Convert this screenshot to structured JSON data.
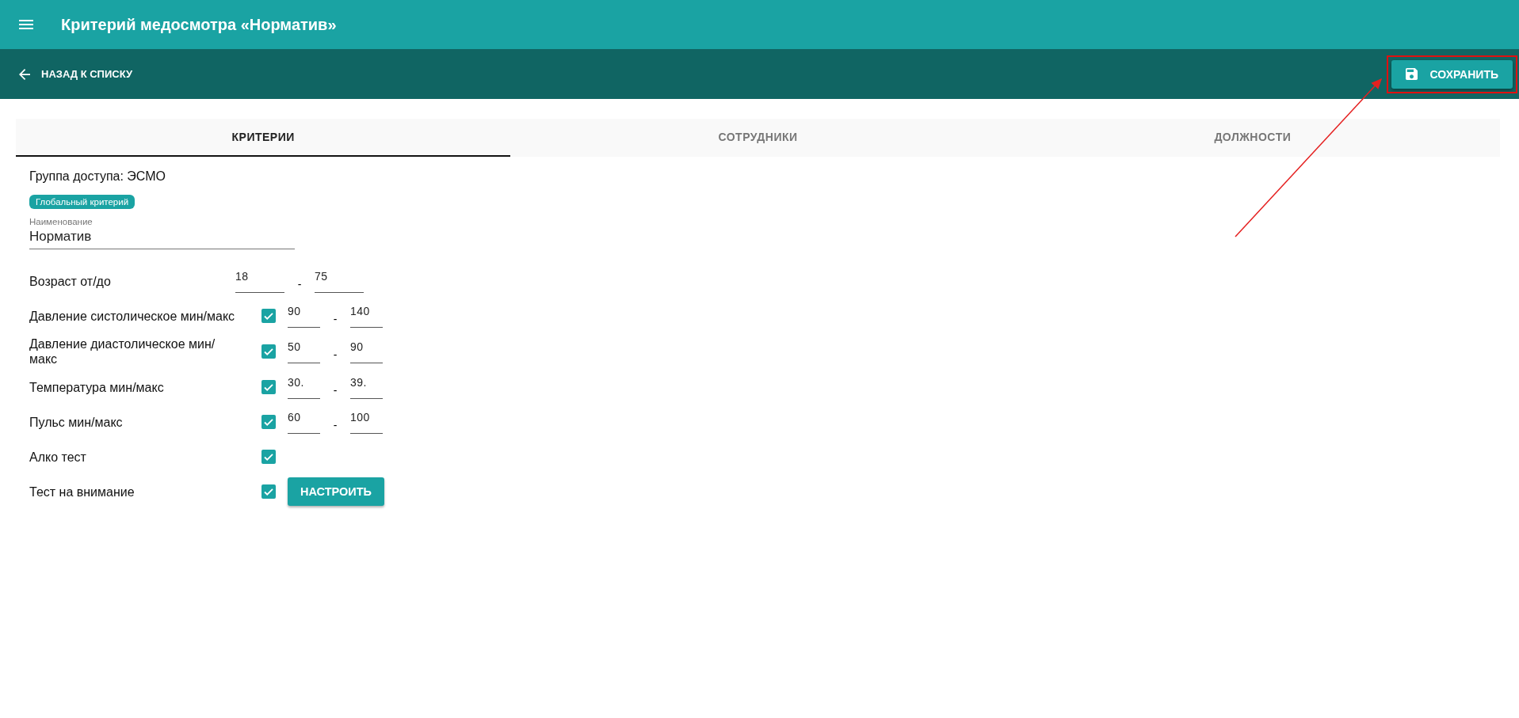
{
  "app_bar": {
    "title": "Критерий медосмотра «Норматив»"
  },
  "toolbar": {
    "back_label": "НАЗАД К СПИСКУ",
    "save_label": "СОХРАНИТЬ",
    "save_highlighted": true
  },
  "tabs": [
    {
      "label": "КРИТЕРИИ",
      "selected": true
    },
    {
      "label": "СОТРУДНИКИ",
      "selected": false
    },
    {
      "label": "ДОЛЖНОСТИ",
      "selected": false
    }
  ],
  "access_group": "Группа доступа: ЭСМО",
  "badge": "Глобальный критерий",
  "name_field": {
    "label": "Наименование",
    "value": "Норматив"
  },
  "criteria": [
    {
      "kind": "range",
      "label": "Возраст от/до",
      "min": "18",
      "max": "75",
      "separator": "-"
    },
    {
      "kind": "range_check",
      "label": "Давление систолическое мин/макс",
      "checked": true,
      "min": "90",
      "max": "140",
      "separator": "-"
    },
    {
      "kind": "range_check",
      "label": "Давление диастолическое мин/макс",
      "checked": true,
      "min": "50",
      "max": "90",
      "separator": "-"
    },
    {
      "kind": "range_check",
      "label": "Температура мин/макс",
      "checked": true,
      "min": "30.",
      "max": "39.",
      "separator": "-"
    },
    {
      "kind": "range_check",
      "label": "Пульс мин/макс",
      "checked": true,
      "min": "60",
      "max": "100",
      "separator": "-"
    },
    {
      "kind": "check",
      "label": "Алко тест",
      "checked": true
    },
    {
      "kind": "check_button",
      "label": "Тест на внимание",
      "checked": true,
      "button": "НАСТРОИТЬ"
    }
  ]
}
